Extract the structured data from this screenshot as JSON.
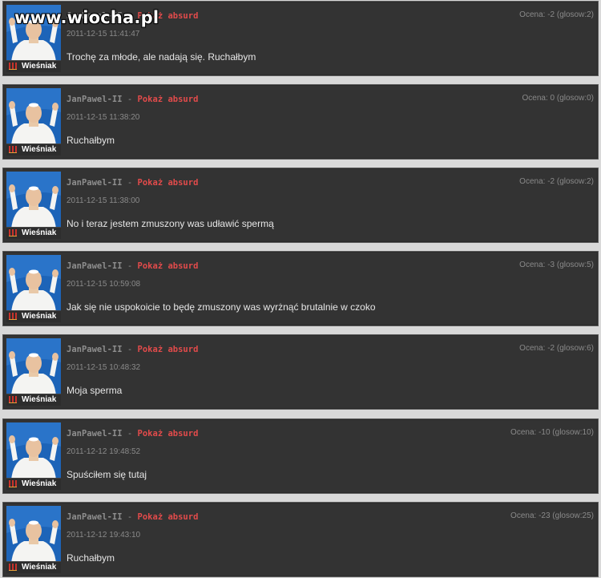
{
  "watermark": "www.wiocha.pl",
  "rank_label": "Wieśniak",
  "separator": "-",
  "absurd_label": "Pokaż absurd",
  "colors": {
    "panel_bg": "#333333",
    "author": "#8e8e8e",
    "absurd_link": "#e24b4b",
    "text": "#e6e6e6",
    "meta": "#8a8a8a"
  },
  "comments": [
    {
      "author": "JanPawel-II",
      "date": "2011-12-15 11:41:47",
      "text": "Trochę za młode, ale nadają się. Ruchałbym",
      "rating": "Ocena: -2 (glosow:2)"
    },
    {
      "author": "JanPawel-II",
      "date": "2011-12-15 11:38:20",
      "text": "Ruchałbym",
      "rating": "Ocena: 0 (glosow:0)"
    },
    {
      "author": "JanPawel-II",
      "date": "2011-12-15 11:38:00",
      "text": "No i teraz jestem zmuszony was udławić spermą",
      "rating": "Ocena: -2 (glosow:2)"
    },
    {
      "author": "JanPawel-II",
      "date": "2011-12-15 10:59:08",
      "text": "Jak się nie uspokoicie to będę zmuszony was wyrżnąć brutalnie w czoko",
      "rating": "Ocena: -3 (glosow:5)"
    },
    {
      "author": "JanPawel-II",
      "date": "2011-12-15 10:48:32",
      "text": "Moja sperma",
      "rating": "Ocena: -2 (glosow:6)"
    },
    {
      "author": "JanPawel-II",
      "date": "2011-12-12 19:48:52",
      "text": "Spuściłem się tutaj",
      "rating": "Ocena: -10 (glosow:10)"
    },
    {
      "author": "JanPawel-II",
      "date": "2011-12-12 19:43:10",
      "text": "Ruchałbym",
      "rating": "Ocena: -23 (glosow:25)"
    }
  ]
}
